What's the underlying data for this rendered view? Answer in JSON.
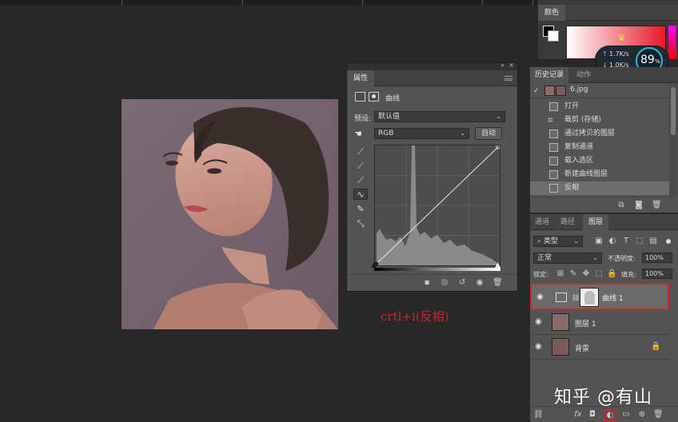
{
  "properties_panel": {
    "tab_label": "属性",
    "adjustment_label": "曲线",
    "preset_label": "预设:",
    "preset_value": "默认值",
    "channel_value": "RGB",
    "auto_button": "自动"
  },
  "color_panel": {
    "tab_label": "颜色"
  },
  "network_widget": {
    "upload": "1.7K/s",
    "download": "1.0K/s",
    "percent": "89",
    "percent_sign": "%"
  },
  "history_panel": {
    "tab_history": "历史记录",
    "tab_actions": "动作",
    "snapshot_label": "6.jpg",
    "items": [
      "打开",
      "裁剪 (存储)",
      "通过拷贝的图层",
      "复制通道",
      "载入选区",
      "新建曲线图层",
      "反相"
    ]
  },
  "layers_panel": {
    "tab_channels": "通道",
    "tab_paths": "路径",
    "tab_layers": "图层",
    "filter_label": "类型",
    "blend_mode": "正常",
    "opacity_label": "不透明度:",
    "opacity_value": "100%",
    "lock_label": "锁定:",
    "fill_label": "填充:",
    "fill_value": "100%",
    "layers": [
      {
        "name": "曲线 1"
      },
      {
        "name": "图层 1"
      },
      {
        "name": "背景"
      }
    ]
  },
  "annotation": {
    "text": "crtl+i(反相)"
  },
  "watermark": {
    "text": "知乎 @有山"
  },
  "colors": {
    "highlight": "#c8282d",
    "panel_bg": "#535353",
    "canvas_bg": "#282828"
  }
}
